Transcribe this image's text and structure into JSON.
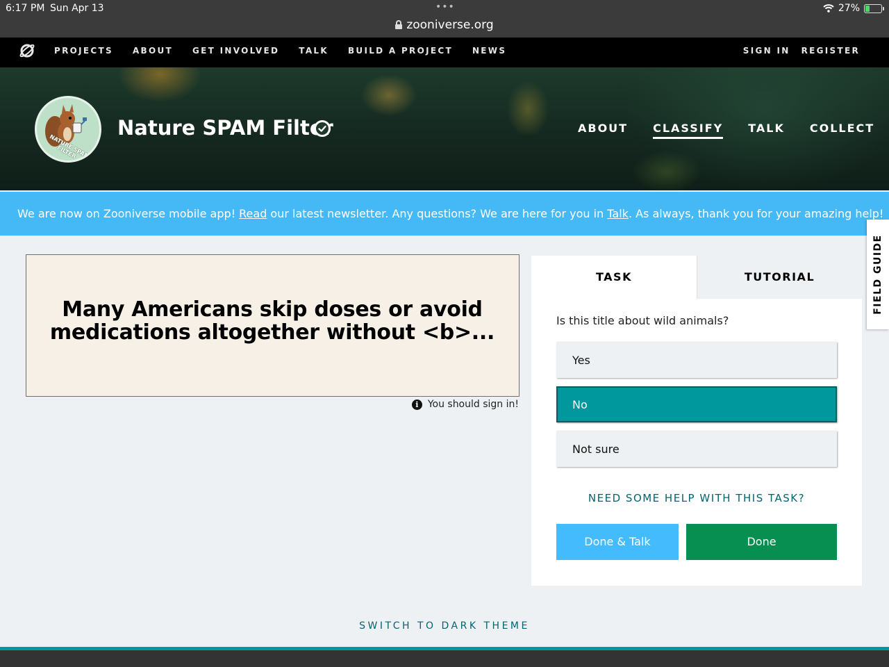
{
  "status_bar": {
    "time": "6:17 PM",
    "date": "Sun Apr 13",
    "url": "zooniverse.org",
    "battery": "27%",
    "battery_level": 0.27,
    "dots": "•••"
  },
  "nav": {
    "links": [
      "PROJECTS",
      "ABOUT",
      "GET INVOLVED",
      "TALK",
      "BUILD A PROJECT",
      "NEWS"
    ],
    "sign_in": "SIGN IN",
    "register": "REGISTER"
  },
  "project": {
    "title": "Nature SPAM Filter",
    "avatar_text": "NATURE SPAM FILTER",
    "nav": [
      "ABOUT",
      "CLASSIFY",
      "TALK",
      "COLLECT"
    ]
  },
  "announcement": {
    "part1": "We are now on Zooniverse mobile app! ",
    "link1": "Read",
    "part2": " our latest newsletter. Any questions? We are here for you in ",
    "link2": "Talk",
    "part3": ". As always, thank you for your amazing help!"
  },
  "subject": {
    "line1": "Many Americans skip doses or avoid",
    "line2": "medications altogether without <b>...",
    "note": "You should sign in!"
  },
  "task": {
    "tab_task": "TASK",
    "tab_tutorial": "TUTORIAL",
    "question": "Is this title about wild animals?",
    "answers": [
      "Yes",
      "No",
      "Not sure"
    ],
    "help": "NEED SOME HELP WITH THIS TASK?",
    "done_talk": "Done & Talk",
    "done": "Done"
  },
  "field_guide": "FIELD GUIDE",
  "theme_toggle": "SWITCH TO DARK THEME",
  "colors": {
    "accent_teal": "#00979d",
    "done_green": "#078f52",
    "announce_blue": "#44b9f5"
  }
}
